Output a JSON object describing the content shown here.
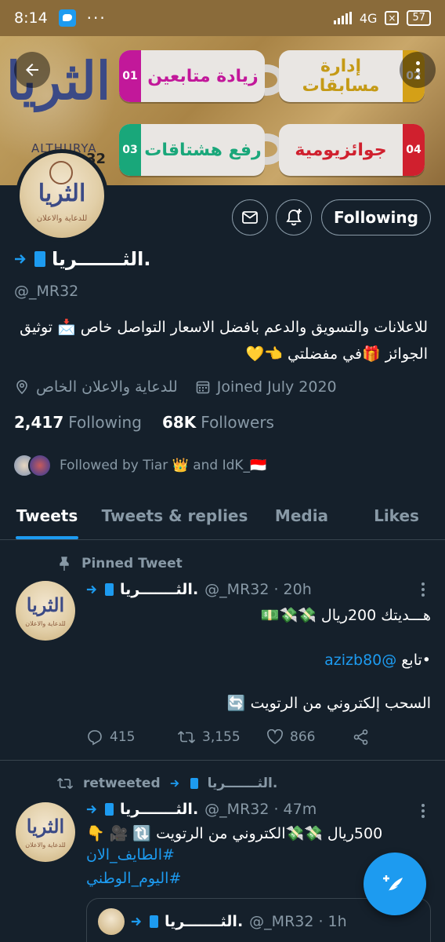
{
  "status_bar": {
    "time": "8:14",
    "dots": "···",
    "network": "4G",
    "battery": "57"
  },
  "banner": {
    "logo_text": "الثريا",
    "logo_sub": "ALTHURYA",
    "pills": [
      {
        "num": "01",
        "text": "زيادة متابعين",
        "color": "#c2189a",
        "text_color": "#c2189a"
      },
      {
        "num": "02",
        "text": "إدارة مسابقات",
        "color": "#d4a017",
        "text_color": "#c59a16"
      },
      {
        "num": "03",
        "text": "رفع هشتاقات",
        "color": "#19a77a",
        "text_color": "#19a77a"
      },
      {
        "num": "04",
        "text": "جوائزيومية",
        "color": "#d0202e",
        "text_color": "#d0202e"
      }
    ],
    "badge_text": "32"
  },
  "profile": {
    "avatar_text": "الثريا",
    "avatar_sub": "للدعاية والاعلان",
    "following_label": "Following",
    "name": "الثـــــــريا.",
    "handle": "@_MR32",
    "bio_line1": "للاعلانات والتسويق والدعم بافضل الاسعار التواصل خاص 📩 توثيق",
    "bio_line2": "الجوائز 🎁في مفضلتي 👈💛",
    "location": "للدعاية والاعلان الخاص",
    "joined": "Joined July 2020",
    "following_count": "2,417",
    "following_text": "Following",
    "followers_count": "68K",
    "followers_text": "Followers",
    "followed_by": "Followed by Tiar 👑 and IdK_🇮🇩"
  },
  "tabs": [
    {
      "label": "Tweets",
      "active": true
    },
    {
      "label": "Tweets & replies",
      "active": false
    },
    {
      "label": "Media",
      "active": false
    },
    {
      "label": "Likes",
      "active": false
    }
  ],
  "tweet1": {
    "context": "Pinned Tweet",
    "name": "الثـــــــريا.",
    "handle": "@_MR32 · 20h",
    "line1": "هـــديتك 200ريال 💸💸💵",
    "line2_prefix": "•تابع ",
    "line2_mention": "@azizb80",
    "line3": "السحب إلكتروني من الرتويت 🔄",
    "replies": "415",
    "retweets": "3,155",
    "likes": "866"
  },
  "tweet2": {
    "context": "retweeted",
    "context_name": "الثـــــــريا.",
    "name": "الثـــــــريا.",
    "handle": "@_MR32 · 47m",
    "line1": "500ريال 💸💸الكتروني من الرتويت 🔃 🎥 👇",
    "hashtag1": "#الطايف_الان",
    "hashtag2": "#اليوم_الوطني"
  },
  "quote": {
    "name": "الثـــــــريا.",
    "handle": "@_MR32 · 1h"
  },
  "colors": {
    "accent": "#1d9bf0",
    "background": "#15202b",
    "muted": "#8899a6"
  }
}
